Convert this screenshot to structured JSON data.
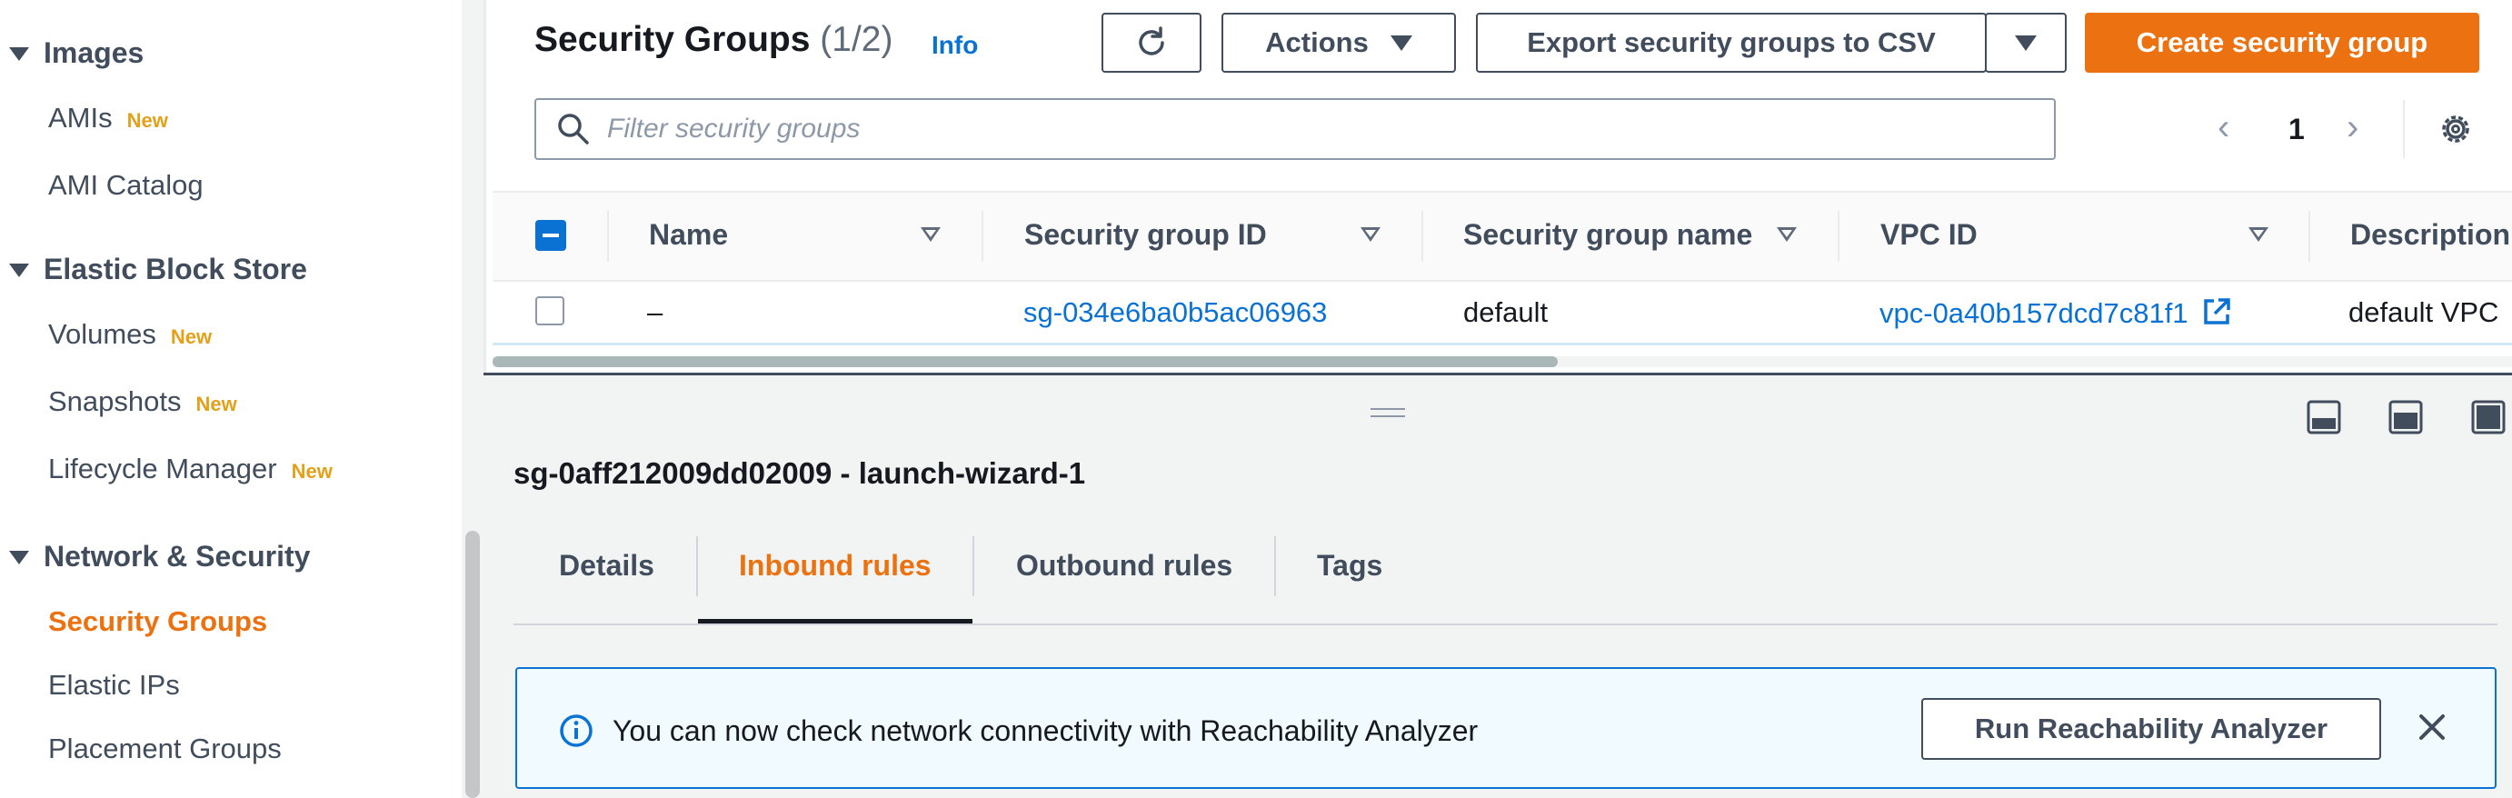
{
  "sidebar": {
    "sections": [
      {
        "label": "Images",
        "items": [
          {
            "label": "AMIs",
            "badge": "New"
          },
          {
            "label": "AMI Catalog",
            "badge": ""
          }
        ]
      },
      {
        "label": "Elastic Block Store",
        "items": [
          {
            "label": "Volumes",
            "badge": "New"
          },
          {
            "label": "Snapshots",
            "badge": "New"
          },
          {
            "label": "Lifecycle Manager",
            "badge": "New"
          }
        ]
      },
      {
        "label": "Network & Security",
        "items": [
          {
            "label": "Security Groups",
            "badge": ""
          },
          {
            "label": "Elastic IPs",
            "badge": ""
          },
          {
            "label": "Placement Groups",
            "badge": ""
          }
        ]
      }
    ],
    "active_item": "Security Groups"
  },
  "header": {
    "title": "Security Groups",
    "count": "(1/2)",
    "info": "Info",
    "actions_label": "Actions",
    "export_label": "Export security groups to CSV",
    "create_label": "Create security group"
  },
  "filter": {
    "placeholder": "Filter security groups",
    "page": "1"
  },
  "table": {
    "columns": [
      "Name",
      "Security group ID",
      "Security group name",
      "VPC ID",
      "Description"
    ],
    "rows": [
      {
        "name": "–",
        "security_group_id": "sg-034e6ba0b5ac06963",
        "security_group_name": "default",
        "vpc_id": "vpc-0a40b157dcd7c81f1",
        "description": "default VPC"
      }
    ]
  },
  "detail_panel": {
    "title": "sg-0aff212009dd02009 - launch-wizard-1",
    "tabs": [
      "Details",
      "Inbound rules",
      "Outbound rules",
      "Tags"
    ],
    "active_tab": "Inbound rules",
    "alert": {
      "text": "You can now check network connectivity with Reachability Analyzer",
      "button_label": "Run Reachability Analyzer"
    }
  },
  "colors": {
    "accent": "#ec7211",
    "link": "#0972d3",
    "badge_new": "#e3a11a",
    "alert_bg": "#f1faff"
  },
  "icons": [
    "caret-down-icon",
    "refresh-icon",
    "search-icon",
    "chevron-left-icon",
    "chevron-right-icon",
    "settings-gear-icon",
    "sort-icon",
    "external-link-icon",
    "drag-handle-icon",
    "panel-bottom-icon",
    "panel-side-icon",
    "panel-hide-icon",
    "info-circle-icon",
    "close-icon"
  ]
}
